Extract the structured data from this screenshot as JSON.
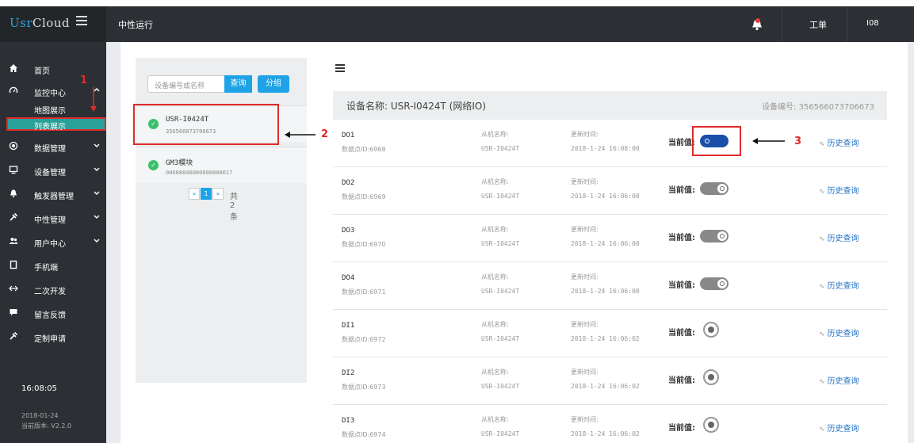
{
  "header": {
    "brand_usr": "Usr",
    "brand_cloud": "Cloud",
    "title": "中性运行",
    "ticket": "工单",
    "user": "I08"
  },
  "sidebar": {
    "items": [
      {
        "label": "首页",
        "icon": "home-icon"
      },
      {
        "label": "监控中心",
        "icon": "monitor-icon"
      },
      {
        "label": "地图展示"
      },
      {
        "label": "列表展示"
      },
      {
        "label": "数据管理",
        "icon": "data-icon"
      },
      {
        "label": "设备管理",
        "icon": "device-icon"
      },
      {
        "label": "触发器管理",
        "icon": "bell-icon"
      },
      {
        "label": "中性管理",
        "icon": "tool-icon"
      },
      {
        "label": "用户中心",
        "icon": "users-icon"
      },
      {
        "label": "手机端",
        "icon": "phone-icon"
      },
      {
        "label": "二次开发",
        "icon": "code-icon"
      },
      {
        "label": "留言反馈",
        "icon": "message-icon"
      },
      {
        "label": "定制申请",
        "icon": "custom-icon"
      }
    ],
    "date": "2018-01-24",
    "version": "当前版本: V2.2.0",
    "clock": "16:08:05"
  },
  "device_panel": {
    "search_placeholder": "设备编号或名称",
    "query_label": "查询",
    "group_label": "分组",
    "devices": [
      {
        "name": "USR-I0424T",
        "no": "356566073706673"
      },
      {
        "name": "GM3模块",
        "no": "00008846000000000017"
      }
    ],
    "pager": {
      "prev": "«",
      "current": "1",
      "next": "»",
      "total": "共2条"
    }
  },
  "detail": {
    "device_name": "设备名称: USR-I0424T (网络IO)",
    "device_no": "设备编号: 356566073706673",
    "slave_label": "从机名称:",
    "update_label": "更新时间:",
    "current_label": "当前值:",
    "history_label": "历史查询",
    "rows": [
      {
        "name": "DO1",
        "id": "数据点ID:6968",
        "slave": "USR-I0424T",
        "time": "2018-1-24 16:08:00",
        "kind": "toggle",
        "on": true
      },
      {
        "name": "DO2",
        "id": "数据点ID:6969",
        "slave": "USR-I0424T",
        "time": "2018-1-24 16:06:00",
        "kind": "toggle",
        "on": false
      },
      {
        "name": "DO3",
        "id": "数据点ID:6970",
        "slave": "USR-I0424T",
        "time": "2018-1-24 16:06:00",
        "kind": "toggle",
        "on": false
      },
      {
        "name": "DO4",
        "id": "数据点ID:6971",
        "slave": "USR-I0424T",
        "time": "2018-1-24 16:06:00",
        "kind": "toggle",
        "on": false
      },
      {
        "name": "DI1",
        "id": "数据点ID:6972",
        "slave": "USR-I0424T",
        "time": "2018-1-24 16:06:02",
        "kind": "radio"
      },
      {
        "name": "DI2",
        "id": "数据点ID:6973",
        "slave": "USR-I0424T",
        "time": "2018-1-24 16:06:02",
        "kind": "radio"
      },
      {
        "name": "DI3",
        "id": "数据点ID:6974",
        "slave": "USR-I0424T",
        "time": "2018-1-24 16:06:02",
        "kind": "radio"
      }
    ]
  },
  "annotations": {
    "n1": "1",
    "n2": "2",
    "n3": "3",
    "color": "#e02b2b"
  }
}
